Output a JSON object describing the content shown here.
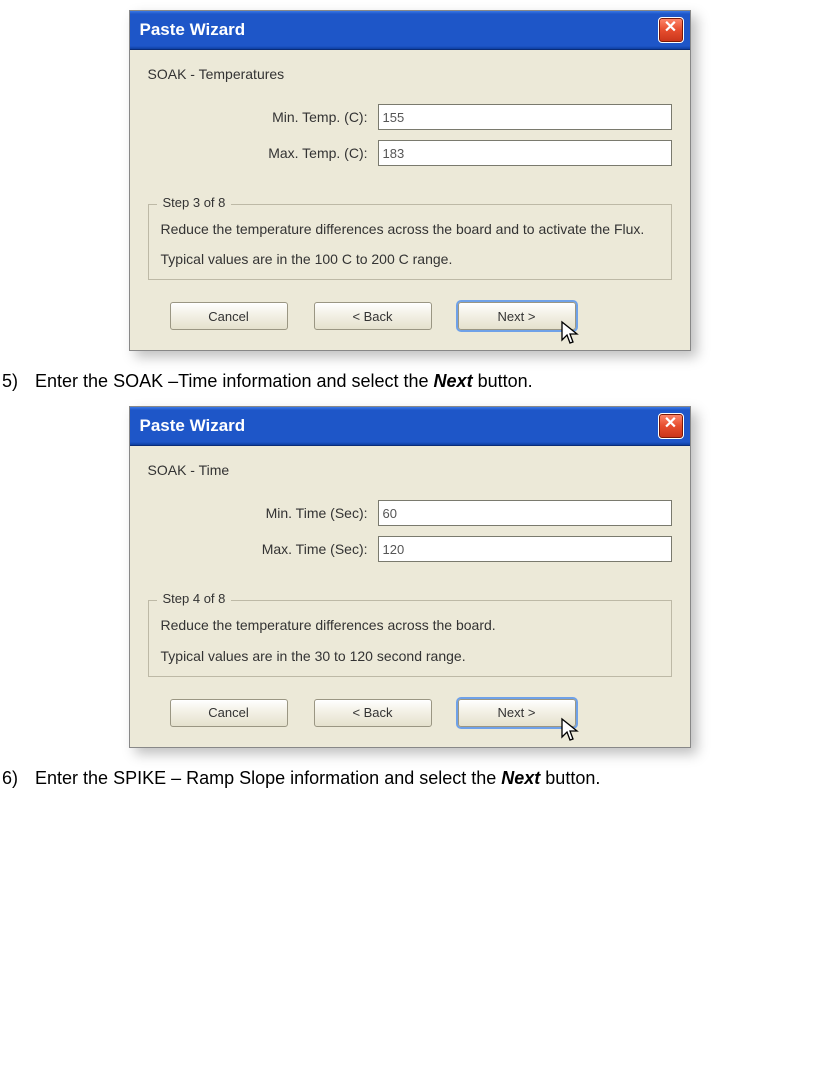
{
  "dialogs": [
    {
      "title": "Paste Wizard",
      "close_glyph": "✕",
      "subtitle": "SOAK - Temperatures",
      "fields": [
        {
          "label": "Min. Temp. (C):",
          "value": "155"
        },
        {
          "label": "Max. Temp. (C):",
          "value": "183"
        }
      ],
      "step_legend": "Step 3 of 8",
      "step_desc": "Reduce the temperature differences across the board and to activate the Flux.",
      "step_typical": "Typical values are in the 100 C to 200 C range.",
      "buttons": {
        "cancel": "Cancel",
        "back": "< Back",
        "next": "Next >"
      }
    },
    {
      "title": "Paste Wizard",
      "close_glyph": "✕",
      "subtitle": "SOAK - Time",
      "fields": [
        {
          "label": "Min. Time (Sec):",
          "value": "60"
        },
        {
          "label": "Max. Time (Sec):",
          "value": "120"
        }
      ],
      "step_legend": "Step 4 of 8",
      "step_desc": "Reduce the temperature differences across the board.",
      "step_typical": "Typical values are in the 30 to 120 second range.",
      "buttons": {
        "cancel": "Cancel",
        "back": "< Back",
        "next": "Next >"
      }
    }
  ],
  "instructions": [
    {
      "num": "5)",
      "text_before": "Enter the SOAK –Time information and select the ",
      "bold": "Next",
      "text_after": " button."
    },
    {
      "num": "6)",
      "text_before": "Enter the SPIKE – Ramp Slope information and select the ",
      "bold": "Next",
      "text_after": " button."
    }
  ]
}
